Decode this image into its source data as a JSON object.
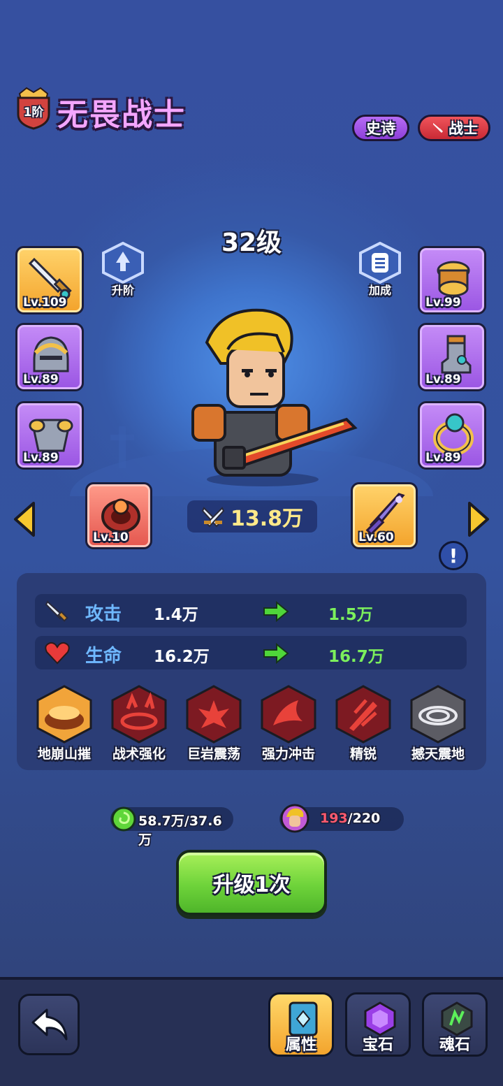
{
  "header": {
    "rank": "1阶",
    "hero_name": "无畏战士",
    "rarity_tag": "史诗",
    "class_tag": "战士",
    "class_icon": "sword-icon"
  },
  "hero": {
    "level_text": "32级",
    "power": "13.8万"
  },
  "actions": {
    "ascend_label": "升阶",
    "bonus_label": "加成"
  },
  "equipment": {
    "left": [
      {
        "icon": "sword-icon",
        "level": "Lv.109",
        "rarity": "gold"
      },
      {
        "icon": "helmet-icon",
        "level": "Lv.89",
        "rarity": "purple"
      },
      {
        "icon": "armor-icon",
        "level": "Lv.89",
        "rarity": "purple"
      }
    ],
    "right": [
      {
        "icon": "bracer-icon",
        "level": "Lv.99",
        "rarity": "purple"
      },
      {
        "icon": "boots-icon",
        "level": "Lv.89",
        "rarity": "purple"
      },
      {
        "icon": "ring-icon",
        "level": "Lv.89",
        "rarity": "purple"
      }
    ],
    "extra_left": {
      "icon": "fire-ring-icon",
      "level": "Lv.10",
      "rarity": "red"
    },
    "extra_right": {
      "icon": "purple-sword-icon",
      "level": "Lv.60",
      "rarity": "gold"
    }
  },
  "stats": [
    {
      "name": "攻击",
      "icon": "sword-icon",
      "current": "1.4万",
      "next": "1.5万"
    },
    {
      "name": "生命",
      "icon": "heart-icon",
      "current": "16.2万",
      "next": "16.7万"
    }
  ],
  "skills": [
    {
      "name": "地崩山摧",
      "icon": "earthquake-icon"
    },
    {
      "name": "战术强化",
      "icon": "tactics-icon"
    },
    {
      "name": "巨岩震荡",
      "icon": "rock-blast-icon"
    },
    {
      "name": "强力冲击",
      "icon": "impact-icon"
    },
    {
      "name": "精锐",
      "icon": "elite-icon"
    },
    {
      "name": "撼天震地",
      "icon": "vortex-icon"
    }
  ],
  "resources": {
    "exp": "58.7万/37.6万",
    "shards_current": "193",
    "shards_total": "/220"
  },
  "upgrade_button": "升级1次",
  "bottom_nav": [
    {
      "label": "属性",
      "icon": "attribute-book-icon",
      "active": true
    },
    {
      "label": "宝石",
      "icon": "gem-icon",
      "active": false
    },
    {
      "label": "魂石",
      "icon": "soul-stone-icon",
      "active": false
    }
  ],
  "colors": {
    "background": "#32457f",
    "name": "#f4a6ff",
    "stat_name": "#6fb8ff",
    "stat_next": "#7cf05c",
    "upgrade_green": "#6ed33a",
    "gold": "#f3a32b",
    "purple": "#9a55e3"
  }
}
